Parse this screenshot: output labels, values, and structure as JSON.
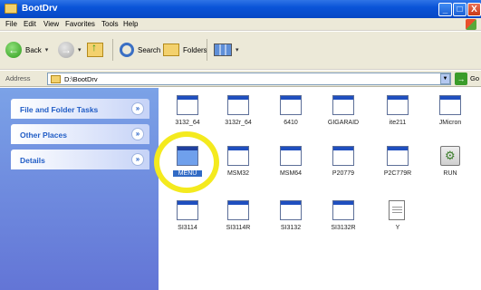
{
  "window": {
    "title": "BootDrv",
    "buttons": {
      "minimize": "_",
      "maximize": "□",
      "close": "X"
    }
  },
  "menubar": [
    "File",
    "Edit",
    "View",
    "Favorites",
    "Tools",
    "Help"
  ],
  "toolbar": {
    "back_label": "Back",
    "search_label": "Search",
    "folders_label": "Folders"
  },
  "address": {
    "label": "Address",
    "value": "D:\\BootDrv",
    "go_label": "Go"
  },
  "taskpane": {
    "panels": [
      {
        "label": "File and Folder Tasks",
        "chevron": "»"
      },
      {
        "label": "Other Places",
        "chevron": "»"
      },
      {
        "label": "Details",
        "chevron": "»"
      }
    ]
  },
  "files": [
    {
      "name": "3132_64",
      "type": "window"
    },
    {
      "name": "3132r_64",
      "type": "window"
    },
    {
      "name": "6410",
      "type": "window"
    },
    {
      "name": "GIGARAID",
      "type": "window"
    },
    {
      "name": "ite211",
      "type": "window"
    },
    {
      "name": "JMicron",
      "type": "window"
    },
    {
      "name": "MENU",
      "type": "window",
      "selected": true
    },
    {
      "name": "MSM32",
      "type": "window"
    },
    {
      "name": "MSM64",
      "type": "window"
    },
    {
      "name": "P20779",
      "type": "window"
    },
    {
      "name": "P2C779R",
      "type": "window"
    },
    {
      "name": "RUN",
      "type": "batch"
    },
    {
      "name": "SI3114",
      "type": "window"
    },
    {
      "name": "SI3114R",
      "type": "window"
    },
    {
      "name": "SI3132",
      "type": "window"
    },
    {
      "name": "SI3132R",
      "type": "window"
    },
    {
      "name": "Y",
      "type": "text"
    }
  ],
  "colors": {
    "titlebar": "#0a54d8",
    "taskpane": "#7ba2e7",
    "selection": "#316ac5",
    "highlight_ring": "#f4ea1e"
  }
}
